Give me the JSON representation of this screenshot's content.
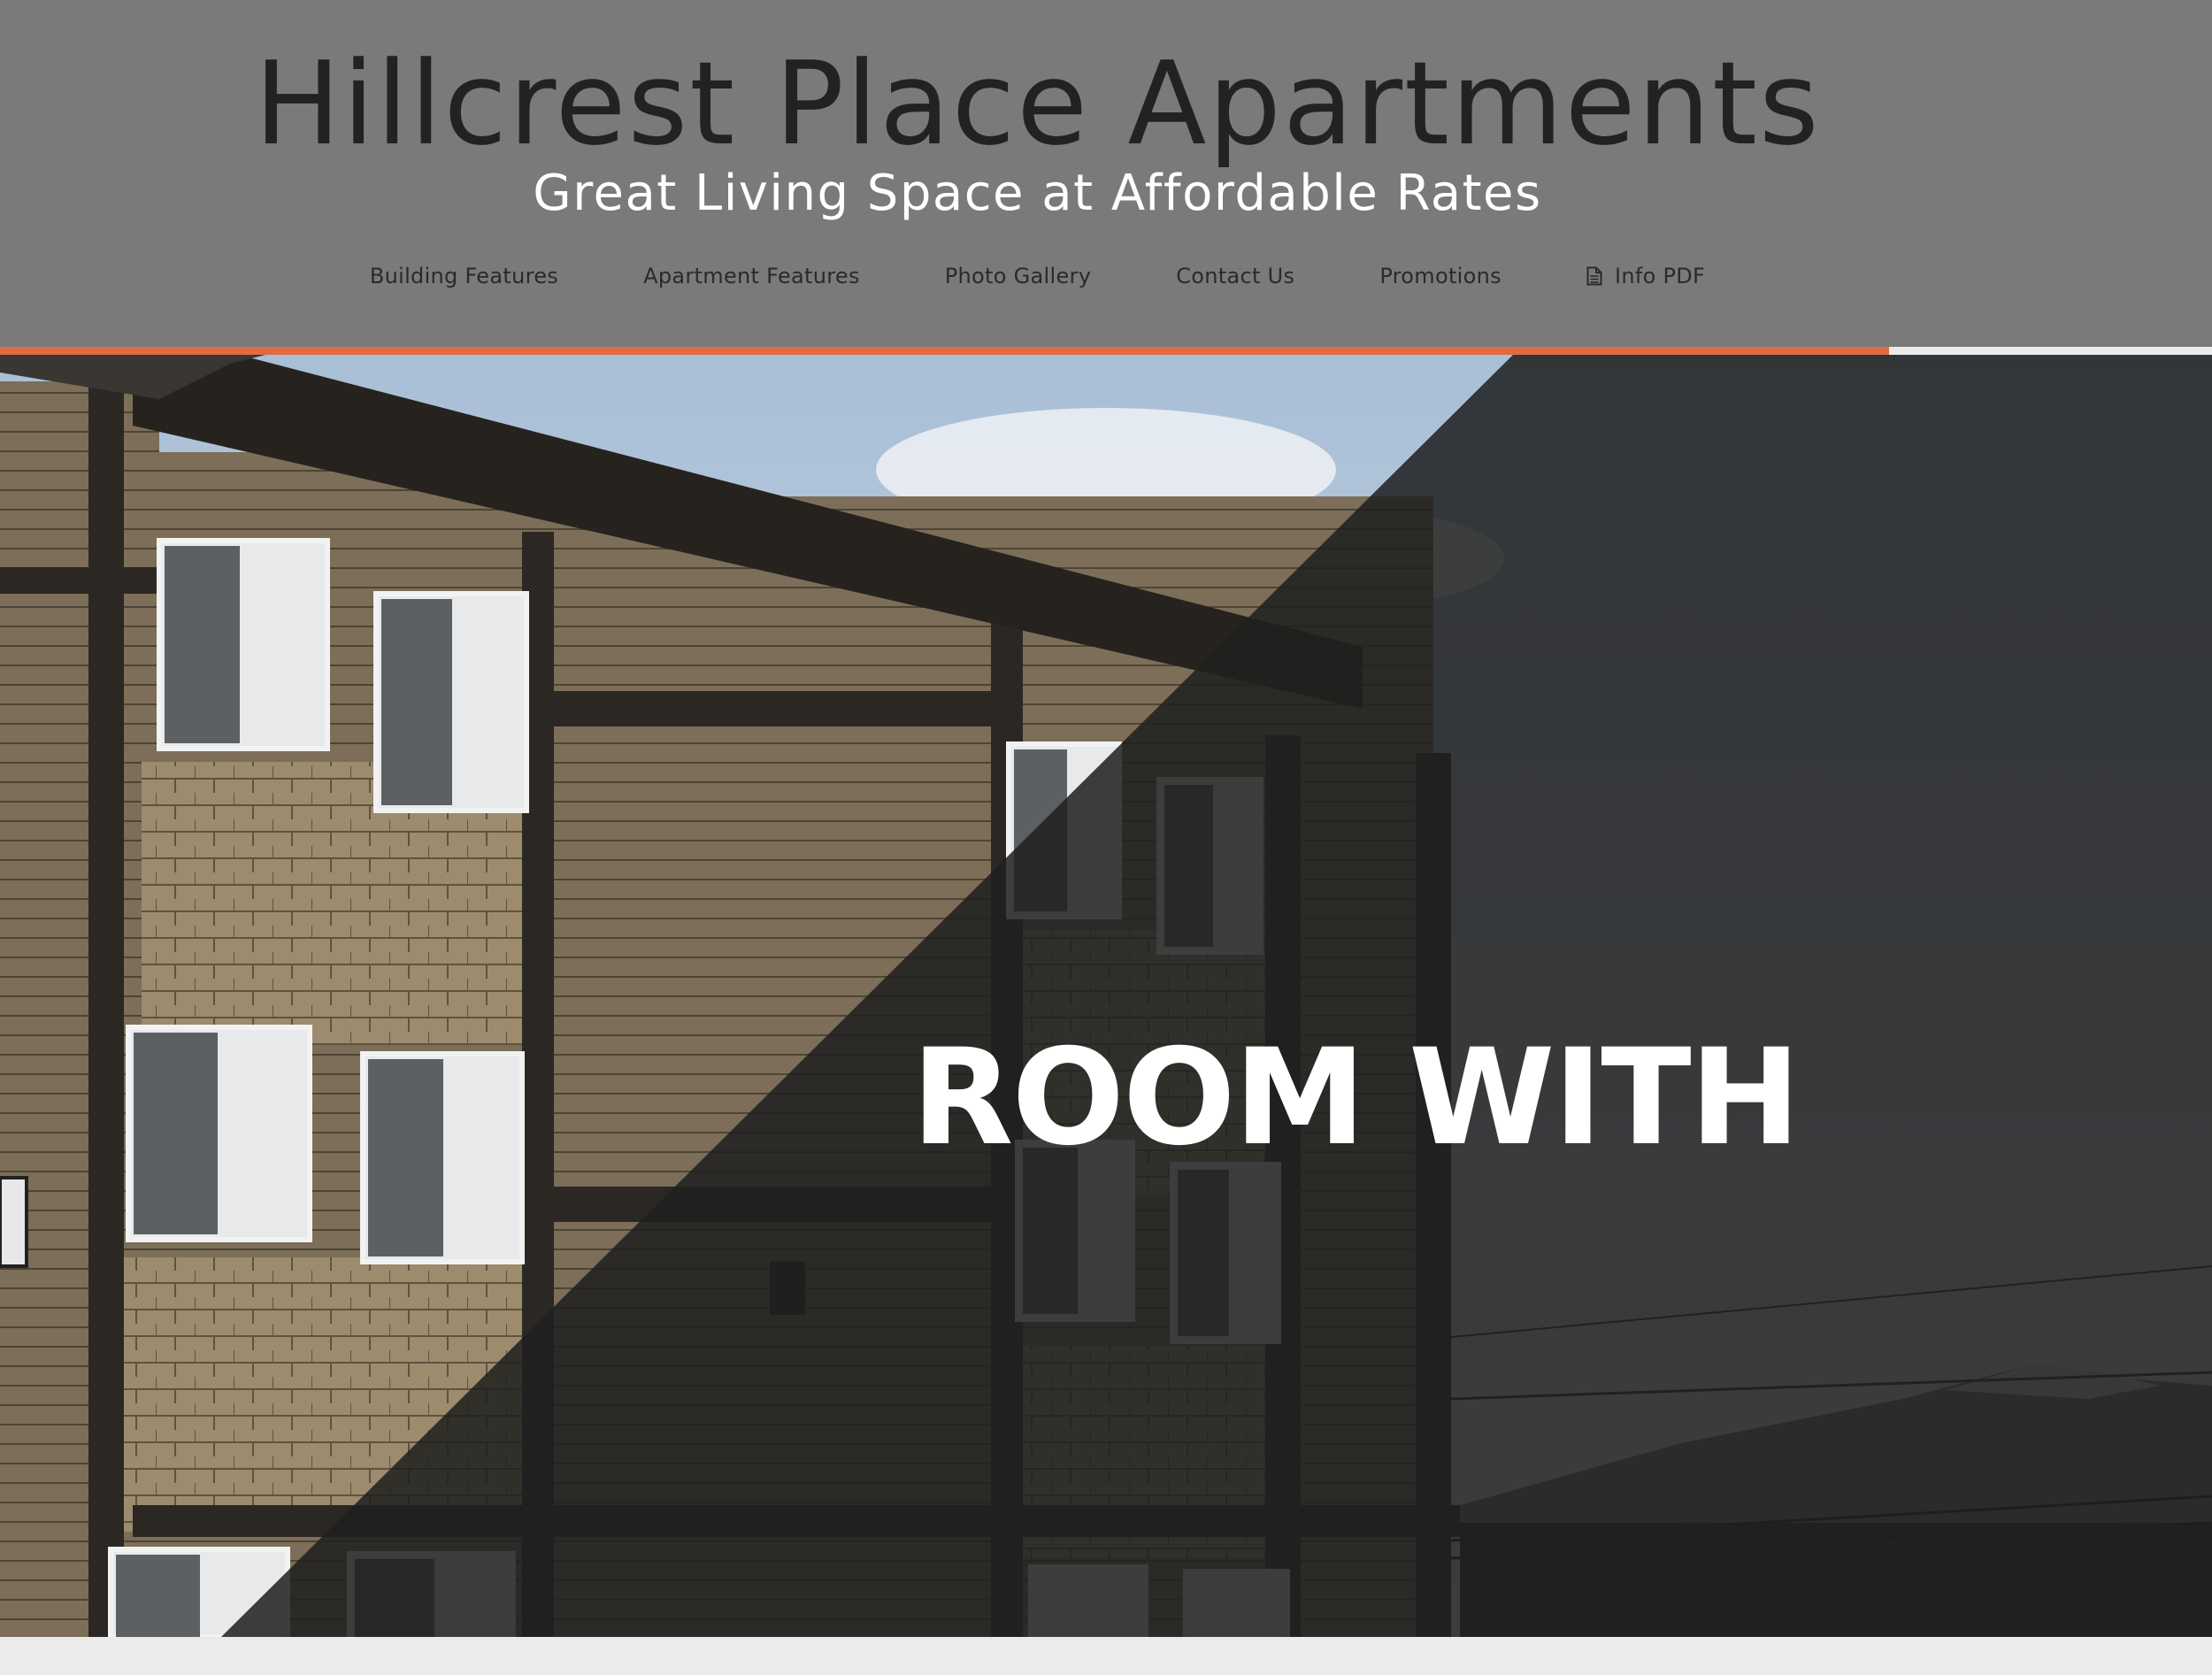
{
  "header": {
    "title": "Hillcrest Place Apartments",
    "tagline": "Great Living Space at Affordable Rates"
  },
  "nav": {
    "items": [
      {
        "label": "Building Features"
      },
      {
        "label": "Apartment Features"
      },
      {
        "label": "Photo Gallery"
      },
      {
        "label": "Contact Us"
      },
      {
        "label": "Promotions"
      },
      {
        "label": "Info PDF",
        "icon": "document-icon"
      }
    ]
  },
  "hero": {
    "headline": "ROOM WITH"
  },
  "colors": {
    "header_bg": "#7b7a79",
    "accent": "#e06b44",
    "title": "#222222",
    "overlay": "#202020"
  }
}
